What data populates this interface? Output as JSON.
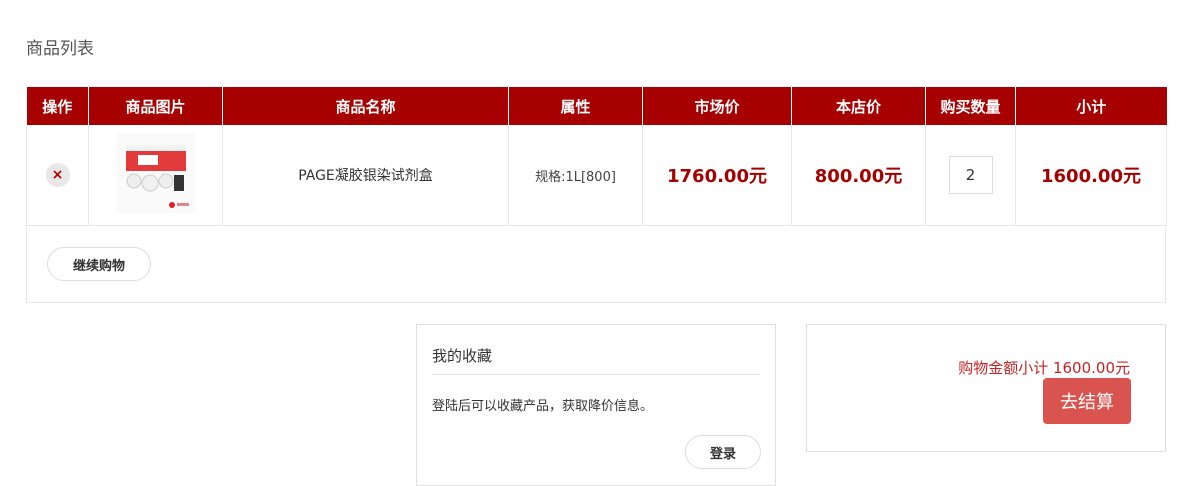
{
  "page": {
    "title": "商品列表"
  },
  "table": {
    "headers": {
      "action": "操作",
      "image": "商品图片",
      "name": "商品名称",
      "attr": "属性",
      "market_price": "市场价",
      "shop_price": "本店价",
      "quantity": "购买数量",
      "subtotal": "小计"
    },
    "rows": [
      {
        "remove_icon": "×",
        "name": "PAGE凝胶银染试剂盒",
        "attr": "规格:1L[800]",
        "market_price": "1760.00元",
        "shop_price": "800.00元",
        "quantity": "2",
        "subtotal": "1600.00元"
      }
    ],
    "continue_label": "继续购物"
  },
  "favorites": {
    "title": "我的收藏",
    "message": "登陆后可以收藏产品，获取降价信息。",
    "login_label": "登录"
  },
  "summary": {
    "total_text": "购物金额小计 1600.00元",
    "checkout_label": "去结算"
  },
  "colors": {
    "header_bg": "#a60000",
    "price": "#a30000",
    "checkout_bg": "#d9534f"
  },
  "icons": {
    "remove": "close-icon",
    "product_image": "product-thumbnail"
  }
}
